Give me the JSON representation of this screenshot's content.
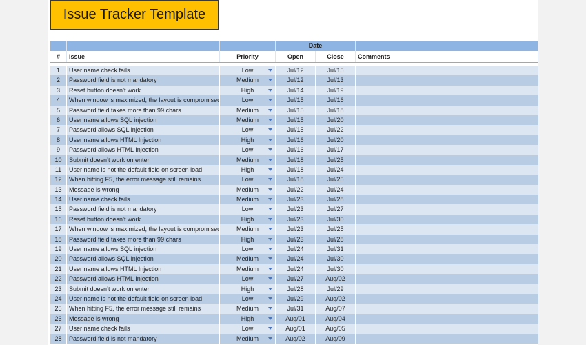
{
  "title": "Issue Tracker Template",
  "header": {
    "group": "Date",
    "num": "#",
    "issue": "Issue",
    "priority": "Priority",
    "open": "Open",
    "close": "Close",
    "comments": "Comments"
  },
  "accent_color": "#ffc000",
  "header_color": "#8eb4e3",
  "rows": [
    {
      "num": "1",
      "issue": "User name check fails",
      "priority": "Low",
      "open": "Jul/12",
      "close": "Jul/15",
      "comments": ""
    },
    {
      "num": "2",
      "issue": "Password field is not mandatory",
      "priority": "Medium",
      "open": "Jul/12",
      "close": "Jul/13",
      "comments": ""
    },
    {
      "num": "3",
      "issue": "Reset button doesn’t work",
      "priority": "High",
      "open": "Jul/14",
      "close": "Jul/19",
      "comments": ""
    },
    {
      "num": "4",
      "issue": "When window is maximized, the layout is compromised",
      "priority": "Low",
      "open": "Jul/15",
      "close": "Jul/16",
      "comments": ""
    },
    {
      "num": "5",
      "issue": "Password field takes more than 99 chars",
      "priority": "Medium",
      "open": "Jul/15",
      "close": "Jul/18",
      "comments": ""
    },
    {
      "num": "6",
      "issue": "User name allows SQL injection",
      "priority": "Medium",
      "open": "Jul/15",
      "close": "Jul/20",
      "comments": ""
    },
    {
      "num": "7",
      "issue": "Password allows SQL injection",
      "priority": "Low",
      "open": "Jul/15",
      "close": "Jul/22",
      "comments": ""
    },
    {
      "num": "8",
      "issue": "User name allows HTML Injection",
      "priority": "High",
      "open": "Jul/16",
      "close": "Jul/20",
      "comments": ""
    },
    {
      "num": "9",
      "issue": "Password allows HTML Injection",
      "priority": "Low",
      "open": "Jul/16",
      "close": "Jul/17",
      "comments": ""
    },
    {
      "num": "10",
      "issue": "Submit doesn’t work on enter",
      "priority": "Medium",
      "open": "Jul/18",
      "close": "Jul/25",
      "comments": ""
    },
    {
      "num": "11",
      "issue": "User name is not the default field on screen load",
      "priority": "High",
      "open": "Jul/18",
      "close": "Jul/24",
      "comments": ""
    },
    {
      "num": "12",
      "issue": "When hitting F5, the error message still remains",
      "priority": "Low",
      "open": "Jul/18",
      "close": "Jul/25",
      "comments": ""
    },
    {
      "num": "13",
      "issue": "Message is wrong",
      "priority": "Medium",
      "open": "Jul/22",
      "close": "Jul/24",
      "comments": ""
    },
    {
      "num": "14",
      "issue": "User name check fails",
      "priority": "Medium",
      "open": "Jul/23",
      "close": "Jul/28",
      "comments": ""
    },
    {
      "num": "15",
      "issue": "Password field is not mandatory",
      "priority": "Low",
      "open": "Jul/23",
      "close": "Jul/27",
      "comments": ""
    },
    {
      "num": "16",
      "issue": "Reset button doesn’t work",
      "priority": "High",
      "open": "Jul/23",
      "close": "Jul/30",
      "comments": ""
    },
    {
      "num": "17",
      "issue": "When window is maximized, the layout is compromised",
      "priority": "Medium",
      "open": "Jul/23",
      "close": "Jul/25",
      "comments": ""
    },
    {
      "num": "18",
      "issue": "Password field takes more than 99 chars",
      "priority": "High",
      "open": "Jul/23",
      "close": "Jul/28",
      "comments": ""
    },
    {
      "num": "19",
      "issue": "User name allows SQL injection",
      "priority": "Low",
      "open": "Jul/24",
      "close": "Jul/31",
      "comments": ""
    },
    {
      "num": "20",
      "issue": "Password allows SQL injection",
      "priority": "Medium",
      "open": "Jul/24",
      "close": "Jul/30",
      "comments": ""
    },
    {
      "num": "21",
      "issue": "User name allows HTML Injection",
      "priority": "Medium",
      "open": "Jul/24",
      "close": "Jul/30",
      "comments": ""
    },
    {
      "num": "22",
      "issue": "Password allows HTML Injection",
      "priority": "Low",
      "open": "Jul/27",
      "close": "Aug/02",
      "comments": ""
    },
    {
      "num": "23",
      "issue": "Submit doesn’t work on enter",
      "priority": "High",
      "open": "Jul/28",
      "close": "Jul/29",
      "comments": ""
    },
    {
      "num": "24",
      "issue": "User name is not the default field on screen load",
      "priority": "Low",
      "open": "Jul/29",
      "close": "Aug/02",
      "comments": ""
    },
    {
      "num": "25",
      "issue": "When hitting F5, the error message still remains",
      "priority": "Medium",
      "open": "Jul/31",
      "close": "Aug/07",
      "comments": ""
    },
    {
      "num": "26",
      "issue": "Message is wrong",
      "priority": "High",
      "open": "Aug/01",
      "close": "Aug/04",
      "comments": ""
    },
    {
      "num": "27",
      "issue": "User name check fails",
      "priority": "Low",
      "open": "Aug/01",
      "close": "Aug/05",
      "comments": ""
    },
    {
      "num": "28",
      "issue": "Password field is not mandatory",
      "priority": "Medium",
      "open": "Aug/02",
      "close": "Aug/09",
      "comments": ""
    }
  ]
}
